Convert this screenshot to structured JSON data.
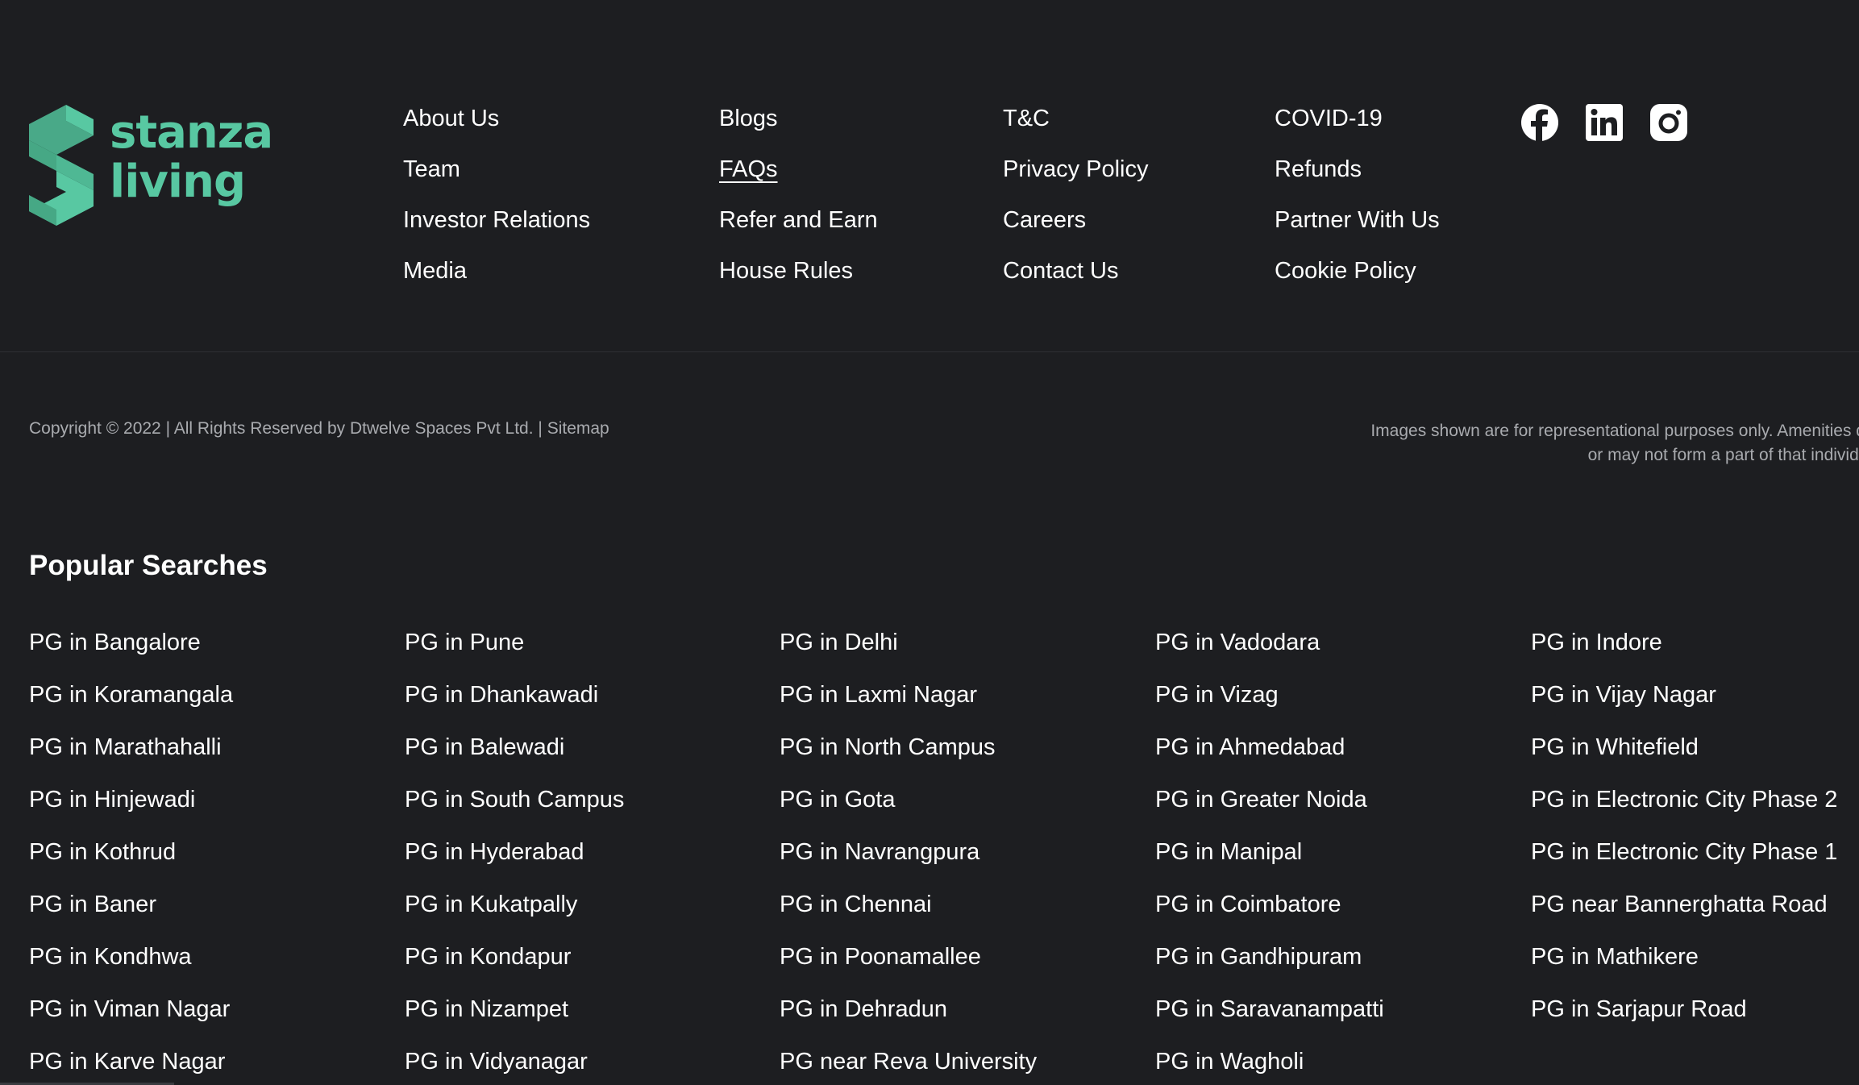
{
  "brand": {
    "name_line1": "stanza",
    "name_line2": "living",
    "color": "#58c8a2"
  },
  "footer_links": {
    "col1": [
      "About Us",
      "Team",
      "Investor Relations",
      "Media"
    ],
    "col2": [
      "Blogs",
      "FAQs",
      "Refer and Earn",
      "House Rules"
    ],
    "col3": [
      "T&C",
      "Privacy Policy",
      "Careers",
      "Contact Us"
    ],
    "col4": [
      "COVID-19",
      "Refunds",
      "Partner With Us",
      "Cookie Policy"
    ]
  },
  "social": {
    "icons": [
      "facebook-icon",
      "linkedin-icon",
      "instagram-icon"
    ]
  },
  "copyright": {
    "text": "Copyright © 2022 | All Rights Reserved by Dtwelve Spaces Pvt Ltd. | ",
    "sitemap": "Sitemap"
  },
  "disclaimer": {
    "line1": "Images shown are for representational purposes only. Amenities depicte",
    "line2": "or may not form a part of that individual pro"
  },
  "popular_searches": {
    "title": "Popular Searches",
    "col1": [
      "PG in Bangalore",
      "PG in Koramangala",
      "PG in Marathahalli",
      "PG in Hinjewadi",
      "PG in Kothrud",
      "PG in Baner",
      "PG in Kondhwa",
      "PG in Viman Nagar",
      "PG in Karve Nagar"
    ],
    "col2": [
      "PG in Pune",
      "PG in Dhankawadi",
      "PG in Balewadi",
      "PG in South Campus",
      "PG in Hyderabad",
      "PG in Kukatpally",
      "PG in Kondapur",
      "PG in Nizampet",
      "PG in Vidyanagar"
    ],
    "col3": [
      "PG in Delhi",
      "PG in Laxmi Nagar",
      "PG in North Campus",
      "PG in Gota",
      "PG in Navrangpura",
      "PG in Chennai",
      "PG in Poonamallee",
      "PG in Dehradun",
      "PG near Reva University"
    ],
    "col4": [
      "PG in Vadodara",
      "PG in Vizag",
      "PG in Ahmedabad",
      "PG in Greater Noida",
      "PG in Manipal",
      "PG in Coimbatore",
      "PG in Gandhipuram",
      "PG in Saravanampatti",
      "PG in Wagholi"
    ],
    "col5": [
      "PG in Indore",
      "PG in Vijay Nagar",
      "PG in Whitefield",
      "PG in Electronic City Phase 2",
      "PG in Electronic City Phase 1",
      "PG near Bannerghatta Road",
      "PG in Mathikere",
      "PG in Sarjapur Road"
    ]
  },
  "colors": {
    "background": "#1d1e21",
    "text": "#ffffff",
    "muted": "#a9abaf"
  }
}
